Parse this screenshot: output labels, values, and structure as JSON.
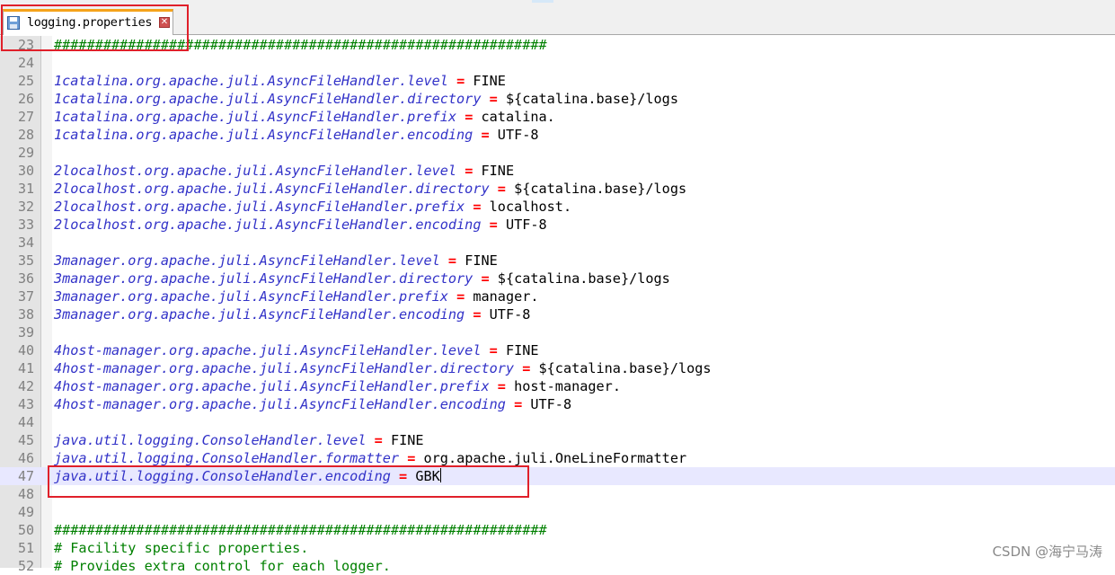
{
  "tab": {
    "filename": "logging.properties"
  },
  "current_line": 47,
  "lines": [
    {
      "n": "23",
      "type": "comment",
      "text": "############################################################"
    },
    {
      "n": "24",
      "type": "blank"
    },
    {
      "n": "25",
      "type": "prop",
      "key": "1catalina.org.apache.juli.AsyncFileHandler.level",
      "value": "FINE"
    },
    {
      "n": "26",
      "type": "prop",
      "key": "1catalina.org.apache.juli.AsyncFileHandler.directory",
      "value": "${catalina.base}/logs"
    },
    {
      "n": "27",
      "type": "prop",
      "key": "1catalina.org.apache.juli.AsyncFileHandler.prefix",
      "value": "catalina."
    },
    {
      "n": "28",
      "type": "prop",
      "key": "1catalina.org.apache.juli.AsyncFileHandler.encoding",
      "value": "UTF-8"
    },
    {
      "n": "29",
      "type": "blank"
    },
    {
      "n": "30",
      "type": "prop",
      "key": "2localhost.org.apache.juli.AsyncFileHandler.level",
      "value": "FINE"
    },
    {
      "n": "31",
      "type": "prop",
      "key": "2localhost.org.apache.juli.AsyncFileHandler.directory",
      "value": "${catalina.base}/logs"
    },
    {
      "n": "32",
      "type": "prop",
      "key": "2localhost.org.apache.juli.AsyncFileHandler.prefix",
      "value": "localhost."
    },
    {
      "n": "33",
      "type": "prop",
      "key": "2localhost.org.apache.juli.AsyncFileHandler.encoding",
      "value": "UTF-8"
    },
    {
      "n": "34",
      "type": "blank"
    },
    {
      "n": "35",
      "type": "prop",
      "key": "3manager.org.apache.juli.AsyncFileHandler.level",
      "value": "FINE"
    },
    {
      "n": "36",
      "type": "prop",
      "key": "3manager.org.apache.juli.AsyncFileHandler.directory",
      "value": "${catalina.base}/logs"
    },
    {
      "n": "37",
      "type": "prop",
      "key": "3manager.org.apache.juli.AsyncFileHandler.prefix",
      "value": "manager."
    },
    {
      "n": "38",
      "type": "prop",
      "key": "3manager.org.apache.juli.AsyncFileHandler.encoding",
      "value": "UTF-8"
    },
    {
      "n": "39",
      "type": "blank"
    },
    {
      "n": "40",
      "type": "prop",
      "key": "4host-manager.org.apache.juli.AsyncFileHandler.level",
      "value": "FINE"
    },
    {
      "n": "41",
      "type": "prop",
      "key": "4host-manager.org.apache.juli.AsyncFileHandler.directory",
      "value": "${catalina.base}/logs"
    },
    {
      "n": "42",
      "type": "prop",
      "key": "4host-manager.org.apache.juli.AsyncFileHandler.prefix",
      "value": "host-manager."
    },
    {
      "n": "43",
      "type": "prop",
      "key": "4host-manager.org.apache.juli.AsyncFileHandler.encoding",
      "value": "UTF-8"
    },
    {
      "n": "44",
      "type": "blank"
    },
    {
      "n": "45",
      "type": "prop",
      "key": "java.util.logging.ConsoleHandler.level",
      "value": "FINE"
    },
    {
      "n": "46",
      "type": "prop",
      "key": "java.util.logging.ConsoleHandler.formatter",
      "value": "org.apache.juli.OneLineFormatter"
    },
    {
      "n": "47",
      "type": "prop",
      "key": "java.util.logging.ConsoleHandler.encoding",
      "value": "GBK"
    },
    {
      "n": "48",
      "type": "blank"
    },
    {
      "n": "49",
      "type": "blank"
    },
    {
      "n": "50",
      "type": "comment",
      "text": "############################################################"
    },
    {
      "n": "51",
      "type": "comment",
      "text": "# Facility specific properties."
    },
    {
      "n": "52",
      "type": "comment",
      "text": "# Provides extra control for each logger."
    }
  ],
  "watermark": "CSDN @海宁马涛",
  "colors": {
    "key": "#3232c8",
    "operator": "#ff0000",
    "comment": "#008000",
    "highlight_box": "#e0202a",
    "current_line": "#e8e8ff"
  }
}
